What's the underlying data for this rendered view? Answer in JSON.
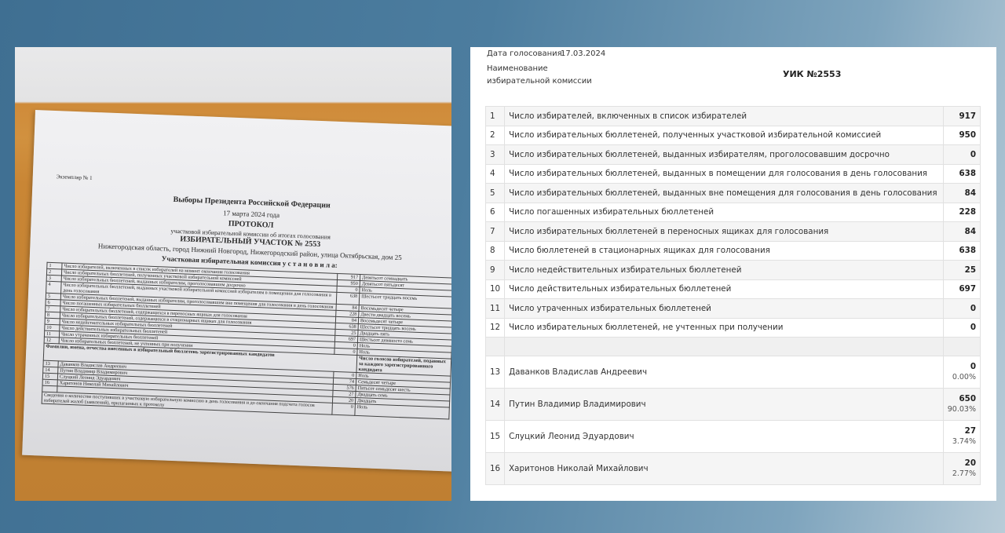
{
  "photo": {
    "copy_label": "Экземпляр № 1",
    "title": "Выборы Президента Российской Федерации",
    "date": "17 марта 2024 года",
    "protocol": "ПРОТОКОЛ",
    "subtitle": "участковой избирательной комиссии об итогах голосования",
    "precinct": "ИЗБИРАТЕЛЬНЫЙ УЧАСТОК № 2553",
    "address": "Нижегородская область, город Нижний Новгород, Нижегородский район, улица Октябрьская, дом 25",
    "established": "Участковая избирательная комиссия у с т а н о в и л а:",
    "rows": [
      {
        "n": "1",
        "text": "Число избирателей, включенных в список избирателей на момент окончания голосования",
        "value": "917",
        "words": "Девятьсот семнадцать"
      },
      {
        "n": "2",
        "text": "Число избирательных бюллетеней, полученных участковой избирательной комиссией",
        "value": "950",
        "words": "Девятьсот пятьдесят"
      },
      {
        "n": "3",
        "text": "Число избирательных бюллетеней, выданных избирателям, проголосовавшим досрочно",
        "value": "0",
        "words": "Ноль"
      },
      {
        "n": "4",
        "text": "Число избирательных бюллетеней, выданных участковой избирательной комиссией избирателям в помещении для голосования в день голосования",
        "value": "638",
        "words": "Шестьсот тридцать восемь"
      },
      {
        "n": "5",
        "text": "Число избирательных бюллетеней, выданных избирателям, проголосовавшим вне помещения для голосования в день голосования",
        "value": "84",
        "words": "Восемьдесят четыре"
      },
      {
        "n": "6",
        "text": "Число погашенных избирательных бюллетеней",
        "value": "228",
        "words": "Двести двадцать восемь"
      },
      {
        "n": "7",
        "text": "Число избирательных бюллетеней, содержащихся в переносных ящиках для голосования",
        "value": "84",
        "words": "Восемьдесят четыре"
      },
      {
        "n": "8",
        "text": "Число избирательных бюллетеней, содержащихся в стационарных ящиках для голосования",
        "value": "638",
        "words": "Шестьсот тридцать восемь"
      },
      {
        "n": "9",
        "text": "Число недействительных избирательных бюллетеней",
        "value": "25",
        "words": "Двадцать пять"
      },
      {
        "n": "10",
        "text": "Число действительных избирательных бюллетеней",
        "value": "697",
        "words": "Шестьсот девяносто семь"
      },
      {
        "n": "11",
        "text": "Число утраченных избирательных бюллетеней",
        "value": "0",
        "words": "Ноль"
      },
      {
        "n": "12",
        "text": "Число избирательных бюллетеней, не учтенных при получении",
        "value": "0",
        "words": "Ноль"
      }
    ],
    "cand_header_left": "Фамилии, имена, отчества внесенных в избирательный бюллетень зарегистрированных кандидатов",
    "cand_header_right": "Число голосов избирателей, поданных за каждого зарегистрированного кандидата",
    "candidates": [
      {
        "n": "13",
        "name": "Даванков Владислав Андреевич",
        "value": "0",
        "words": "Ноль"
      },
      {
        "n": "14",
        "name": "Путин Владимир Владимирович",
        "value": "74",
        "words": "Семьдесят четыре"
      },
      {
        "n": "15",
        "name": "Слуцкий Леонид Эдуардович",
        "value": "576",
        "words": "Пятьсот семьдесят шесть"
      },
      {
        "n": "16",
        "name": "Харитонов Николай Михайлович",
        "value": "27",
        "words": "Двадцать семь"
      },
      {
        "n": "",
        "name": "",
        "value": "20",
        "words": "Двадцать"
      }
    ],
    "footer_text": "Сведения о количестве поступивших в участковую избирательную комиссию в день голосования и до окончания подсчета голосов избирателей жалоб (заявлений), прилагаемых к протоколу",
    "footer_value": "0",
    "footer_words": "Ноль"
  },
  "doc": {
    "vote_date_label": "Дата голосования:",
    "vote_date_value": "17.03.2024",
    "commission_label": "Наименование избирательной комиссии",
    "uik": "УИК №2553",
    "rows": [
      {
        "n": "1",
        "text": "Число избирателей, включенных в список избирателей",
        "value": "917"
      },
      {
        "n": "2",
        "text": "Число избирательных бюллетеней, полученных участковой избирательной комиссией",
        "value": "950"
      },
      {
        "n": "3",
        "text": "Число избирательных бюллетеней, выданных избирателям, проголосовавшим досрочно",
        "value": "0"
      },
      {
        "n": "4",
        "text": "Число избирательных бюллетеней, выданных в помещении для голосования в день голосования",
        "value": "638"
      },
      {
        "n": "5",
        "text": "Число избирательных бюллетеней, выданных вне помещения для голосования в день голосования",
        "value": "84"
      },
      {
        "n": "6",
        "text": "Число погашенных избирательных бюллетеней",
        "value": "228"
      },
      {
        "n": "7",
        "text": "Число избирательных бюллетеней в переносных ящиках для голосования",
        "value": "84"
      },
      {
        "n": "8",
        "text": "Число бюллетеней в стационарных ящиках для голосования",
        "value": "638"
      },
      {
        "n": "9",
        "text": "Число недействительных избирательных бюллетеней",
        "value": "25"
      },
      {
        "n": "10",
        "text": "Число действительных избирательных бюллетеней",
        "value": "697"
      },
      {
        "n": "11",
        "text": "Число утраченных избирательных бюллетеней",
        "value": "0"
      },
      {
        "n": "12",
        "text": "Число избирательных бюллетеней, не учтенных при получении",
        "value": "0"
      }
    ],
    "candidates": [
      {
        "n": "13",
        "name": "Даванков Владислав Андреевич",
        "value": "0",
        "pct": "0.00%"
      },
      {
        "n": "14",
        "name": "Путин Владимир Владимирович",
        "value": "650",
        "pct": "90.03%"
      },
      {
        "n": "15",
        "name": "Слуцкий Леонид Эдуардович",
        "value": "27",
        "pct": "3.74%"
      },
      {
        "n": "16",
        "name": "Харитонов Николай Михайлович",
        "value": "20",
        "pct": "2.77%"
      }
    ]
  }
}
